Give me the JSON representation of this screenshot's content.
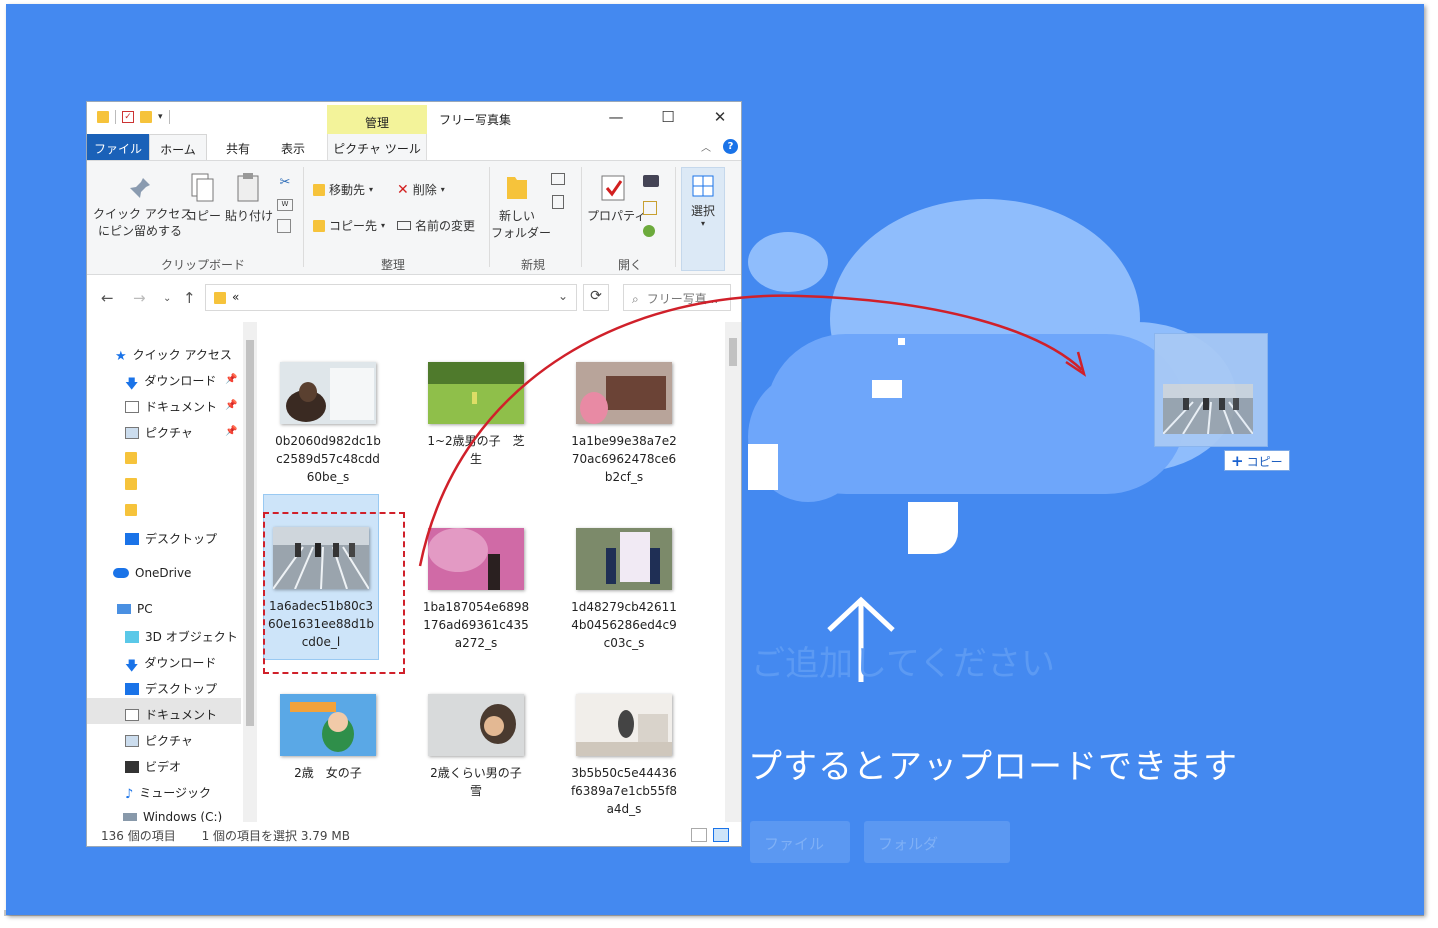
{
  "window": {
    "title": "フリー写真集",
    "context_tab": "管理",
    "context_tool": "ピクチャ ツール"
  },
  "tabs": {
    "file": "ファイル",
    "home": "ホーム",
    "share": "共有",
    "view": "表示"
  },
  "ribbon": {
    "pin": [
      "クイック アクセス",
      "にピン留めする"
    ],
    "copy": "コピー",
    "paste": "貼り付け",
    "move_to": "移動先",
    "delete": "削除",
    "copy_to": "コピー先",
    "rename": "名前の変更",
    "new_folder": [
      "新しい",
      "フォルダー"
    ],
    "properties": "プロパティ",
    "select": "選択",
    "groups": {
      "clipboard": "クリップボード",
      "organize": "整理",
      "new": "新規",
      "open": "開く"
    }
  },
  "address": {
    "path": "«",
    "search_placeholder": "フリー写真..."
  },
  "nav": {
    "quick_access": "クイック アクセス",
    "downloads": "ダウンロード",
    "documents": "ドキュメント",
    "pictures": "ピクチャ",
    "desktop": "デスクトップ",
    "onedrive": "OneDrive",
    "pc": "PC",
    "objects3d": "3D オブジェクト",
    "pc_downloads": "ダウンロード",
    "pc_desktop": "デスクトップ",
    "pc_documents": "ドキュメント",
    "pc_pictures": "ピクチャ",
    "videos": "ビデオ",
    "music": "ミュージック",
    "windows_c": "Windows (C:)"
  },
  "files": [
    {
      "lines": [
        "0b2060d982dc1b",
        "c2589d57c48cdd",
        "60be_s"
      ]
    },
    {
      "lines": [
        "1~2歳男の子　芝",
        "生"
      ]
    },
    {
      "lines": [
        "1a1be99e38a7e2",
        "70ac6962478ce6",
        "b2cf_s"
      ]
    },
    {
      "lines": [
        "1a6adec51b80c3",
        "60e1631ee88d1b",
        "cd0e_l"
      ]
    },
    {
      "lines": [
        "1ba187054e6898",
        "176ad69361c435",
        "a272_s"
      ]
    },
    {
      "lines": [
        "1d48279cb42611",
        "4b0456286ed4c9",
        "c03c_s"
      ]
    },
    {
      "lines": [
        "2歳　女の子"
      ]
    },
    {
      "lines": [
        "2歳くらい男の子",
        "雪"
      ]
    },
    {
      "lines": [
        "3b5b50c5e44436",
        "f6389a7e1cb55f8",
        "a4d_s"
      ]
    }
  ],
  "status": {
    "count": "136 個の項目",
    "selected": "1 個の項目を選択  3.79 MB"
  },
  "drag": {
    "badge": "コピー"
  },
  "upload": {
    "message": "プするとアップロードできます",
    "faint_message": "ご追加してください",
    "faint_btn1": "ファイル",
    "faint_btn2": "フォルダ"
  },
  "colors": {
    "background": "#4489f0",
    "accent": "#1a61b8",
    "selection_outline": "#d0202a",
    "drag_arrow": "#d0202a"
  }
}
